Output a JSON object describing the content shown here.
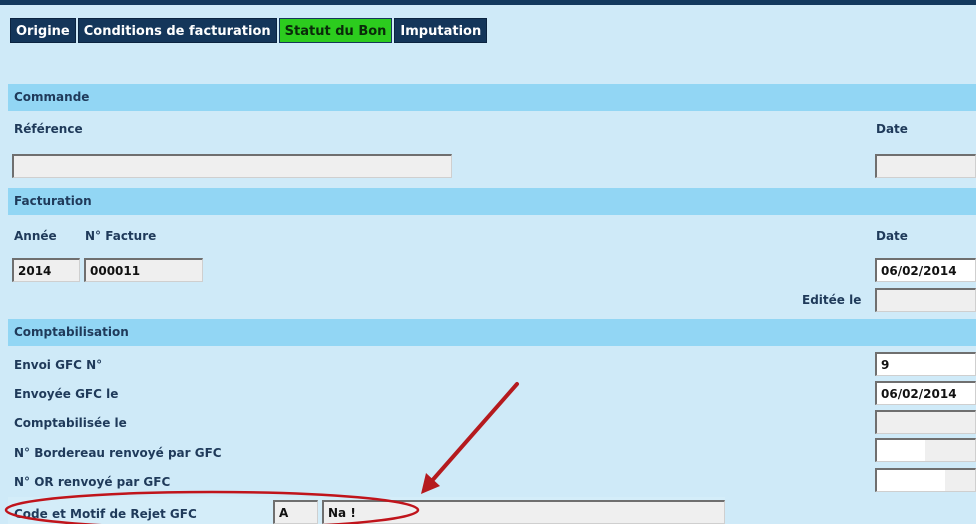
{
  "tabs": [
    {
      "label": "Origine"
    },
    {
      "label": "Conditions de facturation"
    },
    {
      "label": "Statut du Bon"
    },
    {
      "label": "Imputation"
    }
  ],
  "commande": {
    "header": "Commande",
    "reference_label": "Référence",
    "reference_value": "",
    "date_label": "Date",
    "date_value": ""
  },
  "facturation": {
    "header": "Facturation",
    "annee_label": "Année",
    "annee_value": "2014",
    "facture_label": "N° Facture",
    "facture_value": "000011",
    "date_label": "Date",
    "date_value": "06/02/2014",
    "editee_label": "Editée le",
    "editee_value": ""
  },
  "comptabilisation": {
    "header": "Comptabilisation",
    "envoi_label": "Envoi GFC N°",
    "envoi_value": "9",
    "envoyee_label": "Envoyée GFC le",
    "envoyee_value": "06/02/2014",
    "comptabilisee_label": "Comptabilisée le",
    "comptabilisee_value": "",
    "bordereau_label": "N° Bordereau renvoyé par GFC",
    "bordereau_value": "",
    "or_label": "N° OR renvoyé par GFC",
    "or_value": "",
    "rejet_label": "Code et Motif de Rejet GFC",
    "rejet_code": "A",
    "rejet_motif": "Na !"
  },
  "colors": {
    "tab_bg": "#14365a",
    "tab_active_bg": "#2ccc1e",
    "panel_bg": "#cfeaf8",
    "section_bg": "#92d6f4",
    "annotation": "#c0141b"
  }
}
